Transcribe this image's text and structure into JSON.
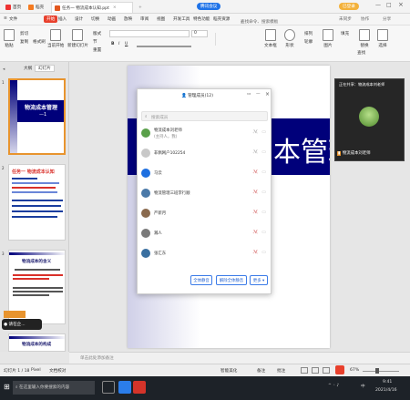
{
  "titlebar": {
    "home": "首页",
    "wps_tab": "稻壳",
    "doc_tab": "任务一 物流成本认知.ppt",
    "meeting_badge": "腾讯会议",
    "new_tab": "+",
    "right_btn": "已登录",
    "share": "分享"
  },
  "menu": {
    "file": "文件",
    "items": [
      "开始",
      "插入",
      "设计",
      "切换",
      "动画",
      "放映",
      "审阅",
      "视图",
      "开发工具",
      "特色功能",
      "稻壳资源"
    ],
    "search": "查找命令、搜索模板",
    "unsync": "未同步",
    "collab": "协作",
    "share": "分享"
  },
  "toolbar": {
    "paste": "粘贴",
    "cut": "剪切",
    "copy": "复制",
    "format_painter": "格式刷",
    "from_current": "当前开始",
    "new_slide": "新建幻灯片",
    "layout": "版式",
    "section": "节",
    "reset": "重置",
    "font_size": "0",
    "bold": "B",
    "italic": "I",
    "underline": "U",
    "textbox": "文本框",
    "shape": "形状",
    "arrange": "排列",
    "outline": "轮廓",
    "picture": "图片",
    "fill": "填充",
    "replace": "替换",
    "select": "选择",
    "find": "查找"
  },
  "leftpanel": {
    "tab_outline": "大纲",
    "tab_slides": "幻灯片",
    "slide1_title": "物流成本管理",
    "slide1_sub": "—1",
    "slide2_title": "任务一 物流成本认知",
    "slide3_title": "物流成本的含义",
    "slide4_title": "物流成本的构成",
    "live_label": "请在企..."
  },
  "slide": {
    "title": "本管理"
  },
  "video": {
    "label": "正在共享：物流成本刘老师",
    "name": "物流成本刘老师"
  },
  "dialog": {
    "title": "管理成员(12)",
    "search_placeholder": "搜索成员",
    "members": [
      {
        "name": "物流成本刘老师",
        "sub": "(主持人，我)",
        "color": "#5aa04a"
      },
      {
        "name": "非佩网户102254",
        "sub": "",
        "color": "#c8c8c8"
      },
      {
        "name": "马云",
        "sub": "",
        "color": "#1d6fe0"
      },
      {
        "name": "物流管理三班李行顺",
        "sub": "",
        "color": "#4a79a8"
      },
      {
        "name": "严新月",
        "sub": "",
        "color": "#8a6a4e"
      },
      {
        "name": "瀚人",
        "sub": "",
        "color": "#7a7a7a"
      },
      {
        "name": "张汇东",
        "sub": "",
        "color": "#3a6fa0"
      }
    ],
    "btn_mute_all": "全体静音",
    "btn_unmute_all": "解除全体静音",
    "btn_more": "更多 ▾"
  },
  "notes": {
    "placeholder": "单击此处添加备注"
  },
  "status": {
    "slide_count": "幻灯片 1 / 18",
    "theme": "Pixel",
    "check": "文档校对",
    "zoom": "67%",
    "smart": "智能美化",
    "notes_btn": "备注",
    "comments": "批注"
  },
  "taskbar": {
    "search": "在这里输入你要搜索的内容",
    "time": "9:41",
    "date": "2021/4/16",
    "lang": "中"
  }
}
